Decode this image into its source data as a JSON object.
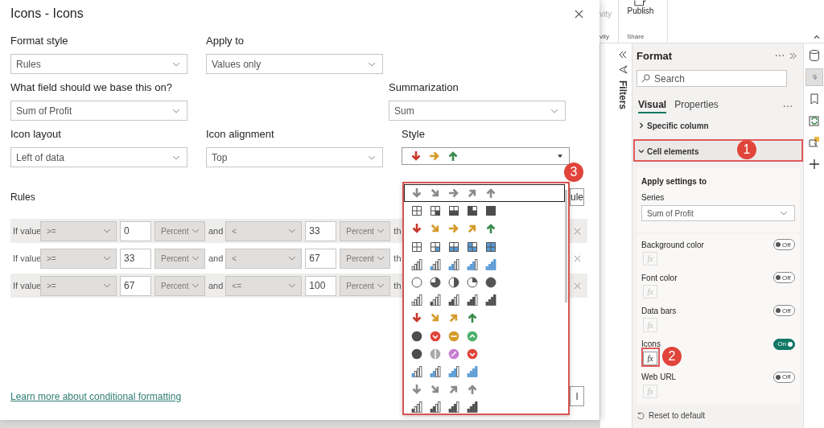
{
  "dialog": {
    "title": "Icons - Icons",
    "field_rows": [
      [
        {
          "kind": "select",
          "label": "Format style",
          "value": "Rules"
        },
        {
          "kind": "select",
          "label": "Apply to",
          "value": "Values only"
        }
      ],
      [
        {
          "kind": "select",
          "label": "What field should we base this on?",
          "value": "Sum of Profit"
        },
        {
          "kind": "select",
          "label": "Summarization",
          "value": "Sum"
        }
      ],
      [
        {
          "kind": "select",
          "label": "Icon layout",
          "value": "Left of data"
        },
        {
          "kind": "select",
          "label": "Icon alignment",
          "value": "Top"
        },
        {
          "kind": "icon-style",
          "label": "Style"
        }
      ]
    ],
    "rules_label": "Rules",
    "new_rule_button": "ule",
    "rules": [
      {
        "prefix": "If value",
        "operator_1": ">=",
        "value_1": "0",
        "unit_1": "Percent",
        "joiner": "and",
        "operator_2": "<",
        "value_2": "33",
        "unit_2": "Percent",
        "suffix": "th"
      },
      {
        "prefix": "If value",
        "operator_1": ">=",
        "value_1": "33",
        "unit_1": "Percent",
        "joiner": "and",
        "operator_2": "<",
        "value_2": "67",
        "unit_2": "Percent",
        "suffix": "th"
      },
      {
        "prefix": "If value",
        "operator_1": ">=",
        "value_1": "67",
        "unit_1": "Percent",
        "joiner": "and",
        "operator_2": "<=",
        "value_2": "100",
        "unit_2": "Percent",
        "suffix": "th"
      }
    ],
    "link": "Learn more about conditional formatting",
    "footer_button": "l",
    "style_options": [
      {
        "selected": true
      },
      {
        "selected": false
      },
      {
        "selected": false
      },
      {
        "selected": false
      },
      {
        "selected": false
      },
      {
        "selected": false
      },
      {
        "selected": false
      },
      {
        "selected": false
      },
      {
        "selected": false
      },
      {
        "selected": false
      },
      {
        "selected": false
      },
      {
        "selected": false
      },
      {
        "selected": false
      }
    ]
  },
  "ribbon": {
    "buttons": [
      {
        "label": "vity"
      },
      {
        "label": "Publish"
      }
    ],
    "groups": [
      {
        "label": "vity"
      },
      {
        "label": "Share"
      }
    ]
  },
  "filters_pane": {
    "title": "Filters"
  },
  "format_pane": {
    "title": "Format",
    "search": {
      "placeholder": "Search"
    },
    "tabs": [
      {
        "label": "Visual",
        "selected": true
      },
      {
        "label": "Properties",
        "selected": false
      }
    ],
    "sections": [
      {
        "label": "Specific column",
        "expanded": false
      },
      {
        "label": "Cell elements",
        "expanded": true
      }
    ],
    "apply_settings": {
      "title": "Apply settings to",
      "series_label": "Series",
      "series_value": "Sum of Profit"
    },
    "toggles": [
      {
        "label": "Background color",
        "on": false,
        "state_text": "Off",
        "fx": "fx"
      },
      {
        "label": "Font color",
        "on": false,
        "state_text": "Off",
        "fx": "fx"
      },
      {
        "label": "Data bars",
        "on": false,
        "state_text": "Off",
        "fx": "fx"
      },
      {
        "label": "Icons",
        "on": true,
        "state_text": "On",
        "fx": "fx"
      },
      {
        "label": "Web URL",
        "on": false,
        "state_text": "Off",
        "fx": "fx"
      }
    ],
    "reset": "Reset to default"
  },
  "icon_rail": [
    {
      "selected": false
    },
    {
      "selected": true
    },
    {
      "selected": false
    },
    {
      "selected": false
    },
    {
      "selected": false
    },
    {
      "selected": false
    }
  ],
  "annotations": [
    {
      "number": "1"
    },
    {
      "number": "2"
    },
    {
      "number": "3"
    }
  ]
}
